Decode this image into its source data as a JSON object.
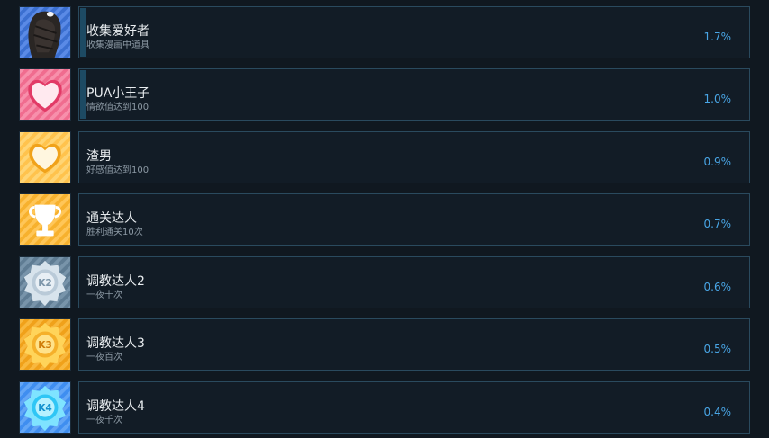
{
  "achievements": [
    {
      "title": "收集爱好者",
      "description": "收集漫画中道具",
      "percent": "1.7%",
      "progress": 0.017,
      "icon": "character-icon"
    },
    {
      "title": "PUA小王子",
      "description": "情欲值达到100",
      "percent": "1.0%",
      "progress": 0.01,
      "icon": "pink-heart-icon"
    },
    {
      "title": "渣男",
      "description": "好感值达到100",
      "percent": "0.9%",
      "progress": 0.009,
      "icon": "yellow-heart-icon"
    },
    {
      "title": "通关达人",
      "description": "胜利通关10次",
      "percent": "0.7%",
      "progress": 0.007,
      "icon": "trophy-icon"
    },
    {
      "title": "调教达人2",
      "description": "一夜十次",
      "percent": "0.6%",
      "progress": 0.006,
      "icon": "k2-badge-icon",
      "badge_text": "K2"
    },
    {
      "title": "调教达人3",
      "description": "一夜百次",
      "percent": "0.5%",
      "progress": 0.005,
      "icon": "k3-badge-icon",
      "badge_text": "K3"
    },
    {
      "title": "调教达人4",
      "description": "一夜千次",
      "percent": "0.4%",
      "progress": 0.004,
      "icon": "k4-badge-icon",
      "badge_text": "K4"
    }
  ],
  "colors": {
    "background": "#101820",
    "card_border": "#2a4a5e",
    "percent_text": "#49a6e6",
    "progress_fill": "#1d4a63"
  }
}
